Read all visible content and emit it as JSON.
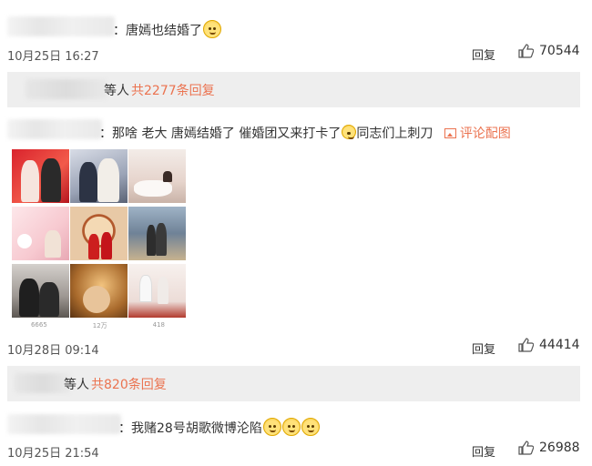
{
  "comments": [
    {
      "text": "：唐嫣也结婚了",
      "date": "10月25日 16:27",
      "reply_label": "回复",
      "likes": "70544"
    },
    {
      "text": "：那啥 老大 唐嫣结婚了 催婚团又来打卡了",
      "text_tail": "同志们上刺刀",
      "pic_link": "评论配图",
      "date": "10月28日 09:14",
      "reply_label": "回复",
      "likes": "44414",
      "photo_stats": [
        "6665",
        "12万",
        "418"
      ]
    },
    {
      "text": "：我赌28号胡歌微博沦陷",
      "date": "10月25日 21:54",
      "reply_label": "回复",
      "likes": "26988"
    }
  ],
  "reply_bars": [
    {
      "who": "等人",
      "count": "共2277条回复"
    },
    {
      "who": "等人",
      "count": "共820条回复"
    }
  ],
  "colors": {
    "accent": "#eb7350",
    "bar_bg": "#eeeeee"
  },
  "icons": {
    "like": "thumbs-up-icon",
    "emoji": "doge-emoji",
    "laugh": "laugh-cry-emoji",
    "picture": "picture-icon"
  }
}
